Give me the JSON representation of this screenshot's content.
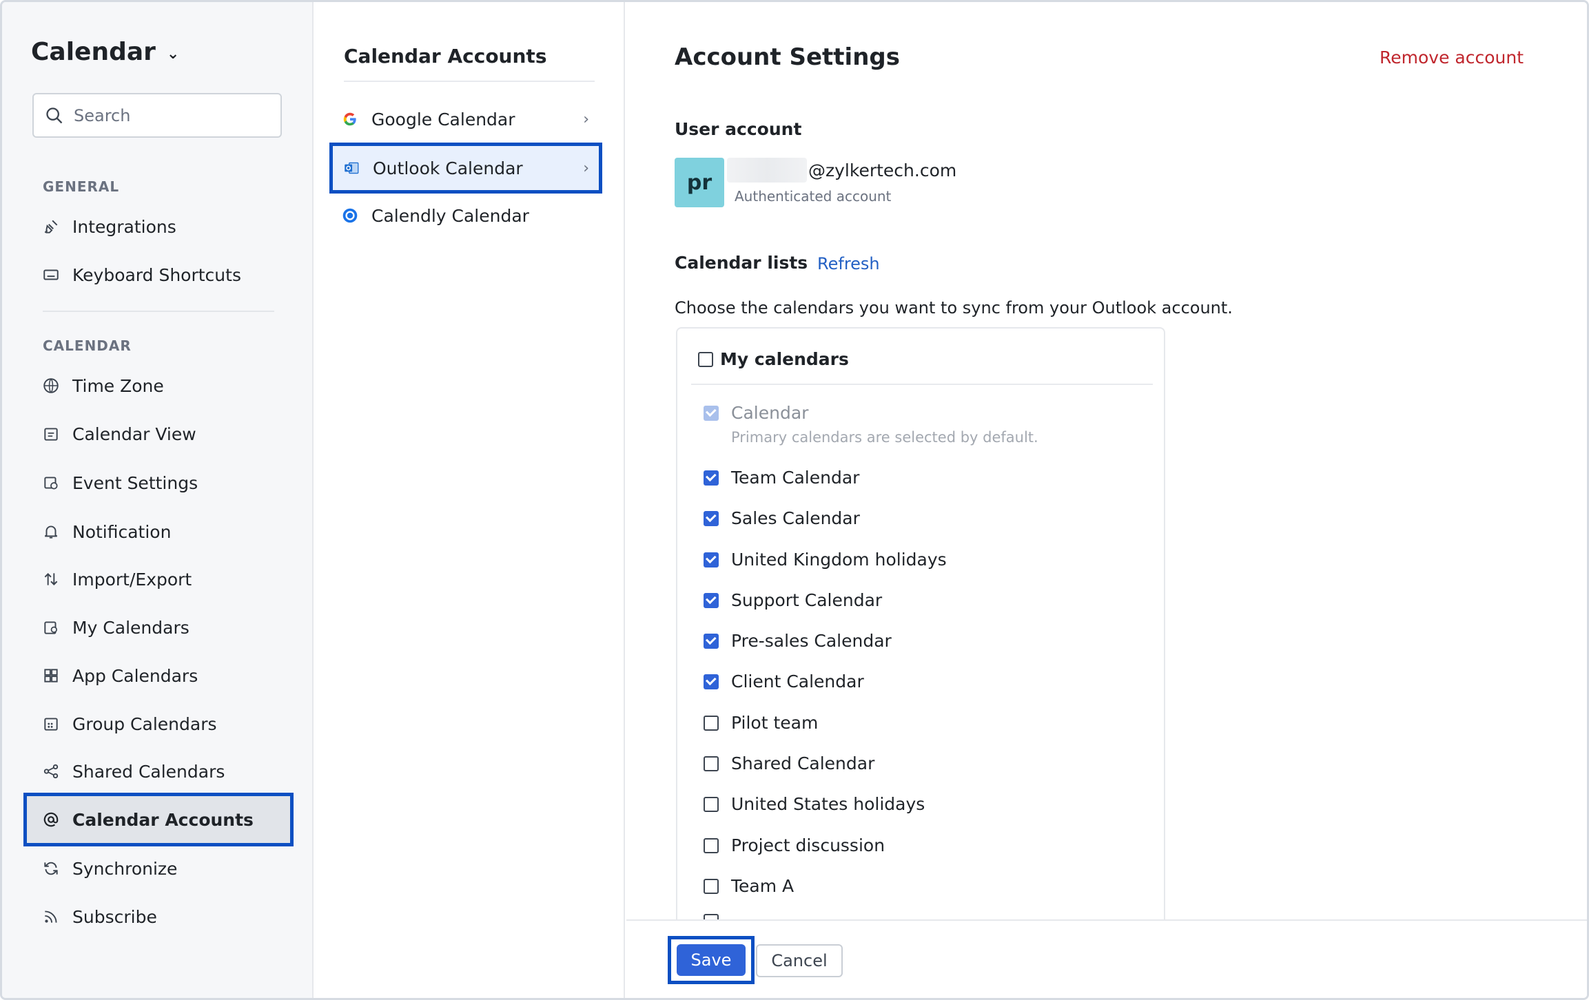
{
  "app": {
    "title": "Calendar"
  },
  "search": {
    "placeholder": "Search"
  },
  "sidebar": {
    "general_label": "GENERAL",
    "general_items": [
      {
        "label": "Integrations",
        "icon": "plug-icon"
      },
      {
        "label": "Keyboard Shortcuts",
        "icon": "keyboard-icon"
      }
    ],
    "calendar_label": "CALENDAR",
    "calendar_items": [
      {
        "label": "Time Zone",
        "icon": "globe-icon"
      },
      {
        "label": "Calendar View",
        "icon": "calendar-view-icon"
      },
      {
        "label": "Event Settings",
        "icon": "event-settings-icon"
      },
      {
        "label": "Notification",
        "icon": "bell-icon"
      },
      {
        "label": "Import/Export",
        "icon": "import-export-icon"
      },
      {
        "label": "My Calendars",
        "icon": "my-calendars-icon"
      },
      {
        "label": "App Calendars",
        "icon": "app-calendars-icon"
      },
      {
        "label": "Group Calendars",
        "icon": "group-calendars-icon"
      },
      {
        "label": "Shared Calendars",
        "icon": "share-icon"
      },
      {
        "label": "Calendar Accounts",
        "icon": "at-sign-icon",
        "active": true
      },
      {
        "label": "Synchronize",
        "icon": "sync-icon"
      },
      {
        "label": "Subscribe",
        "icon": "rss-icon"
      }
    ]
  },
  "accounts": {
    "title": "Calendar Accounts",
    "items": [
      {
        "label": "Google Calendar",
        "icon": "google-icon"
      },
      {
        "label": "Outlook Calendar",
        "icon": "outlook-icon",
        "active": true
      },
      {
        "label": "Calendly Calendar",
        "icon": "calendly-icon"
      }
    ]
  },
  "settings": {
    "title": "Account Settings",
    "remove_label": "Remove account",
    "user_account_label": "User account",
    "avatar_initials": "pr",
    "email_domain": "@zylkertech.com",
    "auth_note": "Authenticated account",
    "calendar_lists_label": "Calendar lists",
    "refresh_label": "Refresh",
    "choose_text": "Choose the calendars you want to sync from your Outlook account.",
    "my_calendars_label": "My calendars",
    "default_note": "Primary calendars are selected by default.",
    "calendars": [
      {
        "label": "Calendar",
        "checked": true,
        "disabled": true
      },
      {
        "label": "Team Calendar",
        "checked": true
      },
      {
        "label": "Sales Calendar",
        "checked": true
      },
      {
        "label": "United Kingdom holidays",
        "checked": true
      },
      {
        "label": "Support Calendar",
        "checked": true
      },
      {
        "label": "Pre-sales Calendar",
        "checked": true
      },
      {
        "label": "Client Calendar",
        "checked": true
      },
      {
        "label": "Pilot team",
        "checked": false
      },
      {
        "label": "Shared Calendar",
        "checked": false
      },
      {
        "label": "United States holidays",
        "checked": false
      },
      {
        "label": "Project discussion",
        "checked": false
      },
      {
        "label": "Team A",
        "checked": false
      }
    ]
  },
  "footer": {
    "save_label": "Save",
    "cancel_label": "Cancel"
  },
  "colors": {
    "accent": "#2f63d8",
    "highlight": "#0b4fc2",
    "danger": "#c0262d",
    "avatar": "#7fd1de"
  }
}
